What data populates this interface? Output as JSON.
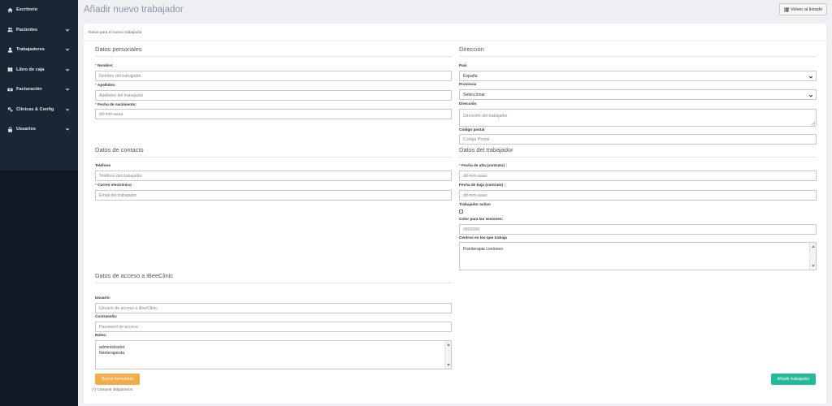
{
  "sidebar": {
    "items": [
      {
        "label": "Escritorio",
        "icon": "home-icon"
      },
      {
        "label": "Pacientes",
        "icon": "users-icon"
      },
      {
        "label": "Trabajadores",
        "icon": "user-icon"
      },
      {
        "label": "Libro de caja",
        "icon": "book-icon"
      },
      {
        "label": "Facturación",
        "icon": "money-icon"
      },
      {
        "label": "Clínicas & Config",
        "icon": "gears-icon"
      },
      {
        "label": "Usuarios",
        "icon": "lock-icon"
      }
    ]
  },
  "header": {
    "title": "Añadir nuevo trabajador",
    "back_label": "Volver al listado"
  },
  "form": {
    "subtitle": "Datos para el nuevo trabajador",
    "personal": {
      "title": "Datos personales",
      "nombre_label": "Nombre:",
      "nombre_placeholder": "Nombre del trabajador",
      "apellidos_label": "Apellidos:",
      "apellidos_placeholder": "Apellidos del trabajador",
      "nacimiento_label": "Fecha de nacimiento:",
      "nacimiento_placeholder": "dd-mm-aaaa"
    },
    "direccion": {
      "title": "Dirección",
      "pais_label": "País",
      "pais_value": "España",
      "provincia_label": "Provincia",
      "provincia_value": "Seleccionar",
      "direccion_label": "Dirección",
      "direccion_placeholder": "Dirección del trabajador",
      "cp_label": "Código postal",
      "cp_placeholder": "Codigo Postal"
    },
    "contacto": {
      "title": "Datos de contacto",
      "telefono_label": "Teléfono",
      "telefono_placeholder": "Teléfono del trabajador",
      "email_label": "Correo electrónico",
      "email_placeholder": "Email del trabajador"
    },
    "trabajador": {
      "title": "Datos del trabajador",
      "alta_label": "Fecha de alta (contrato) :",
      "alta_placeholder": "dd-mm-aaaa",
      "baja_label": "Fecha de baja (contrato) :",
      "baja_placeholder": "dd-mm-aaaa",
      "activo_label": "Trabajador activo",
      "color_label": "Color para las sesiones:",
      "color_value": "#000000",
      "centros_label": "Centros en los que trabaja",
      "centros_options": [
        "Fisioterapia Lesiones"
      ]
    },
    "acceso": {
      "title": "Datos de acceso a iBeeClinic",
      "usuario_label": "Usuario:",
      "usuario_placeholder": "Usuario de acceso a iBeeClinic",
      "password_label": "Contraseña:",
      "password_placeholder": "Password de acceso",
      "roles_label": "Roles:",
      "roles_options": [
        "administrador",
        "fisioterapeuta"
      ]
    },
    "clear_label": "Borrar formulario",
    "add_label": "Añadir trabajador",
    "required_note": "(*) Campos obligatorios",
    "required_mark": "*"
  },
  "colors": {
    "sidebar_bg": "#1a2634",
    "clear_btn": "#f0ad4e",
    "add_btn": "#26b99a"
  }
}
